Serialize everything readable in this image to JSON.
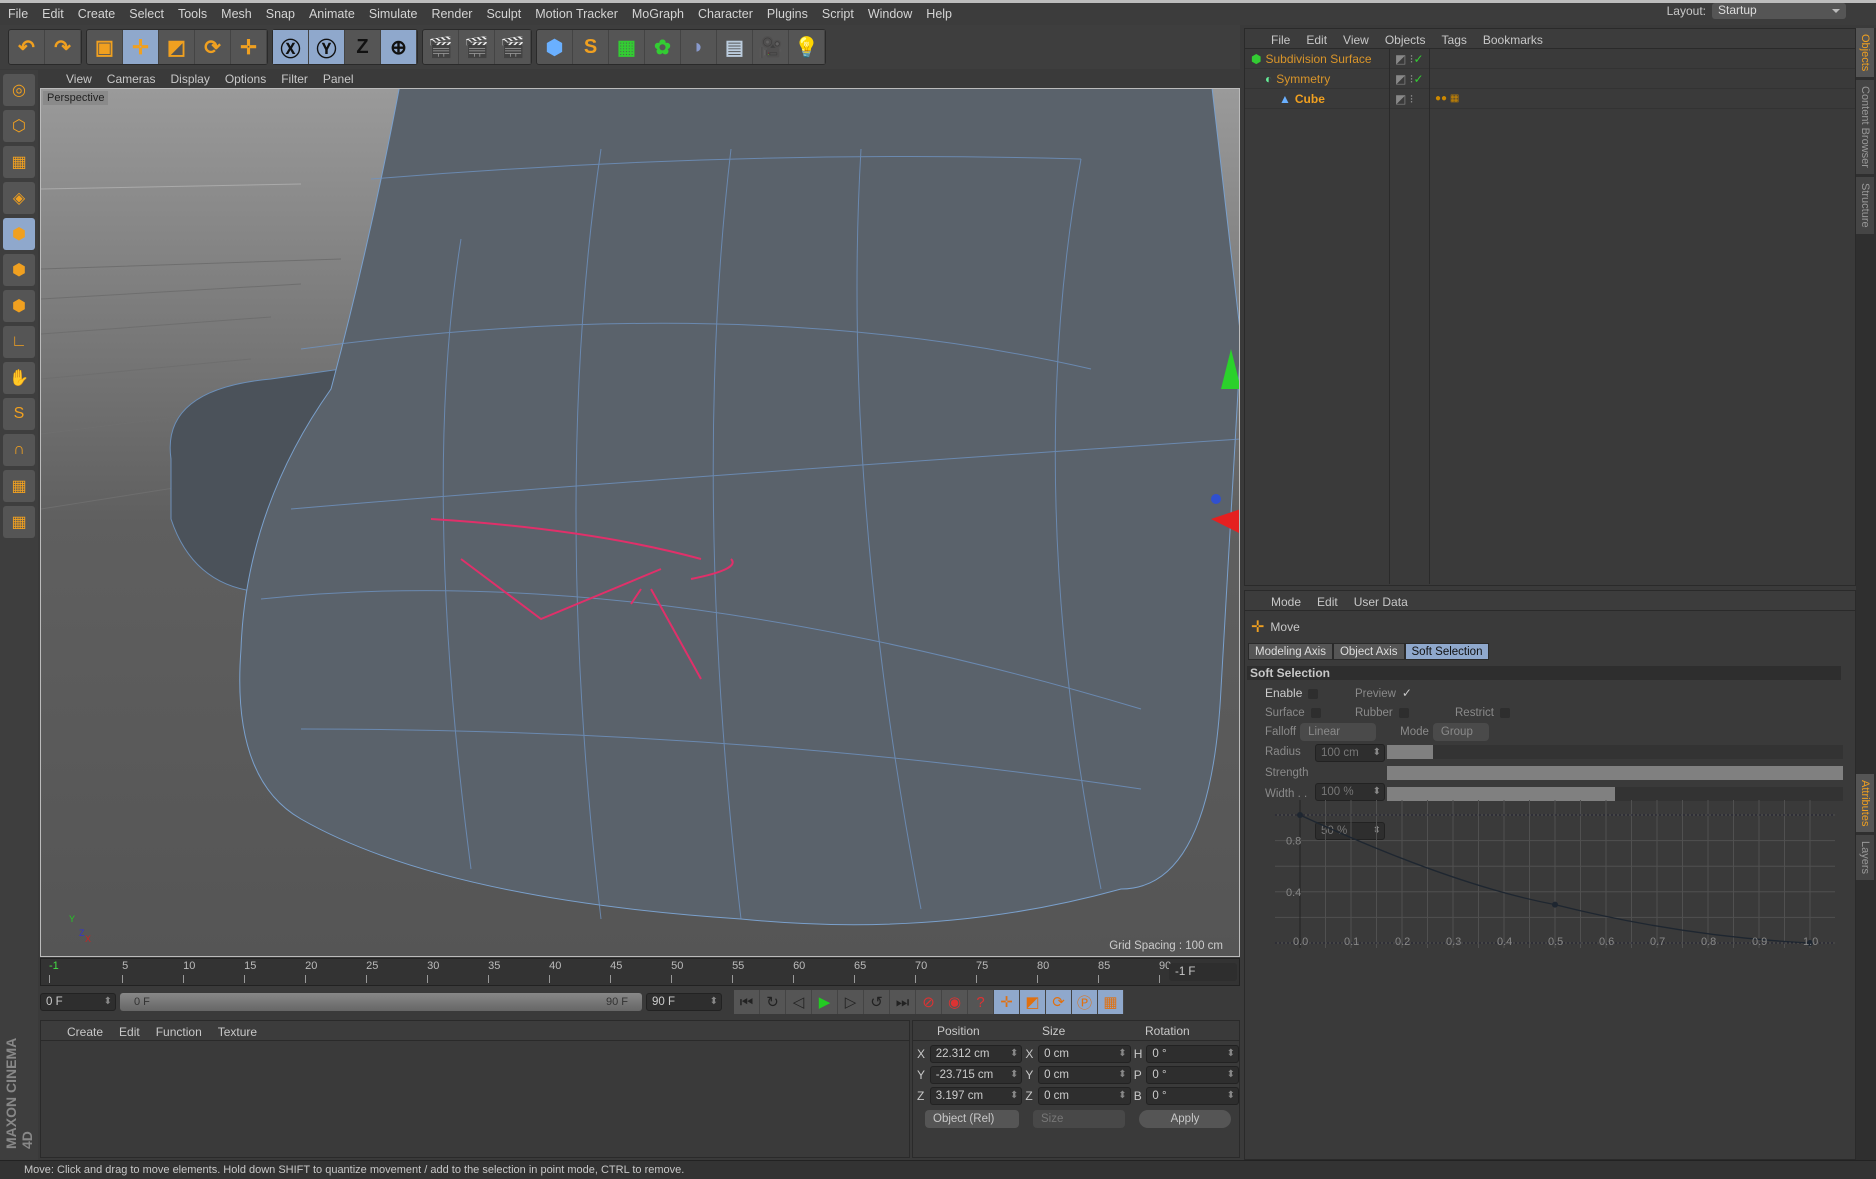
{
  "menu": [
    "File",
    "Edit",
    "Create",
    "Select",
    "Tools",
    "Mesh",
    "Snap",
    "Animate",
    "Simulate",
    "Render",
    "Sculpt",
    "Motion Tracker",
    "MoGraph",
    "Character",
    "Plugins",
    "Script",
    "Window",
    "Help"
  ],
  "layout": {
    "label": "Layout:",
    "value": "Startup"
  },
  "toolbar": [
    [
      "undo-icon",
      "redo-icon"
    ],
    [
      "live-selection-icon",
      "move-icon",
      "scale-icon",
      "rotate-icon",
      "last-tool-icon"
    ],
    [
      "x-axis-lock-icon",
      "y-axis-lock-icon",
      "z-axis-lock-icon",
      "world-coordinates-icon"
    ],
    [
      "render-view-icon",
      "render-picture-viewer-icon",
      "render-settings-icon"
    ],
    [
      "cube-primitive-icon",
      "spline-pen-icon",
      "subdivision-surface-icon",
      "array-icon",
      "deformer-icon",
      "floor-icon",
      "camera-icon",
      "light-icon"
    ]
  ],
  "left_tools": [
    "make-editable-icon",
    "model-mode-icon",
    "texture-mode-icon",
    "workplane-icon",
    "points-mode-icon",
    "edges-mode-icon",
    "polygons-mode-icon",
    "axis-mode-icon",
    "tweak-icon",
    "snap-icon",
    "magnet-icon",
    "grid-icon",
    "quantize-icon"
  ],
  "viewport": {
    "menu": [
      "View",
      "Cameras",
      "Display",
      "Options",
      "Filter",
      "Panel"
    ],
    "camera": "Perspective",
    "grid_spacing": "Grid Spacing : 100 cm",
    "axis": {
      "x": "X",
      "y": "Y",
      "z": "Z"
    }
  },
  "timeline": {
    "ticks": [
      "-1",
      "5",
      "10",
      "15",
      "20",
      "25",
      "30",
      "35",
      "40",
      "45",
      "50",
      "55",
      "60",
      "65",
      "70",
      "75",
      "80",
      "85",
      "90"
    ],
    "current": "-1 F",
    "start": "0 F",
    "range_start": "0 F",
    "range_end": "90 F",
    "end": "90 F"
  },
  "playback_icons": [
    "go-to-start-icon",
    "loop-icon",
    "step-back-icon",
    "play-icon",
    "step-forward-icon",
    "go-to-end-icon",
    "record-off-icon",
    "autokey-icon",
    "keyframe-selection-icon",
    "move-key-icon",
    "scale-key-icon",
    "rotate-key-icon",
    "param-key-icon",
    "pla-key-icon",
    "timeline-icon"
  ],
  "materials": {
    "menu": [
      "Create",
      "Edit",
      "Function",
      "Texture"
    ]
  },
  "coordinates": {
    "headers": [
      "Position",
      "Size",
      "Rotation"
    ],
    "rows": [
      {
        "a": "X",
        "pos": "22.312 cm",
        "sa": "X",
        "size": "0 cm",
        "ra": "H",
        "rot": "0 °"
      },
      {
        "a": "Y",
        "pos": "-23.715 cm",
        "sa": "Y",
        "size": "0 cm",
        "ra": "P",
        "rot": "0 °"
      },
      {
        "a": "Z",
        "pos": "3.197 cm",
        "sa": "Z",
        "size": "0 cm",
        "ra": "B",
        "rot": "0 °"
      }
    ],
    "mode": "Object (Rel)",
    "size_mode": "Size",
    "apply": "Apply"
  },
  "objects": {
    "menu": [
      "File",
      "Edit",
      "View",
      "Objects",
      "Tags",
      "Bookmarks"
    ],
    "items": [
      {
        "name": "Subdivision Surface",
        "icon": "subdivision-surface-icon",
        "depth": 0
      },
      {
        "name": "Symmetry",
        "icon": "symmetry-icon",
        "depth": 1
      },
      {
        "name": "Cube",
        "icon": "cube-polygon-icon",
        "depth": 2
      }
    ]
  },
  "attributes": {
    "menu": [
      "Mode",
      "Edit",
      "User Data"
    ],
    "tool": "Move",
    "tabs": [
      "Modeling Axis",
      "Object Axis",
      "Soft Selection"
    ],
    "active_tab": "Soft Selection",
    "section": "Soft Selection",
    "enable": "Enable",
    "preview": "Preview",
    "surface": "Surface",
    "rubber": "Rubber",
    "restrict": "Restrict",
    "falloff_label": "Falloff",
    "falloff": "Linear",
    "mode_label": "Mode",
    "mode": "Group",
    "radius_label": "Radius",
    "radius": "100 cm",
    "radius_fill": 0.1,
    "strength_label": "Strength",
    "strength": "100 %",
    "strength_fill": 1.0,
    "width_label": "Width . .",
    "width": "50 %",
    "width_fill": 0.5,
    "graph": {
      "x_ticks": [
        "0.0",
        "0.1",
        "0.2",
        "0.3",
        "0.4",
        "0.5",
        "0.6",
        "0.7",
        "0.8",
        "0.9",
        "1.0"
      ],
      "y_ticks": [
        "0.8",
        "0.4"
      ],
      "points": [
        [
          0,
          1
        ],
        [
          0.5,
          0.3
        ],
        [
          1,
          0
        ]
      ]
    }
  },
  "side_tabs": [
    "Objects",
    "Content Browser",
    "Structure",
    "Attributes",
    "Layers"
  ],
  "status": "Move: Click and drag to move elements. Hold down SHIFT to quantize movement / add to the selection in point mode, CTRL to remove.",
  "brand": "MAXON CINEMA 4D"
}
